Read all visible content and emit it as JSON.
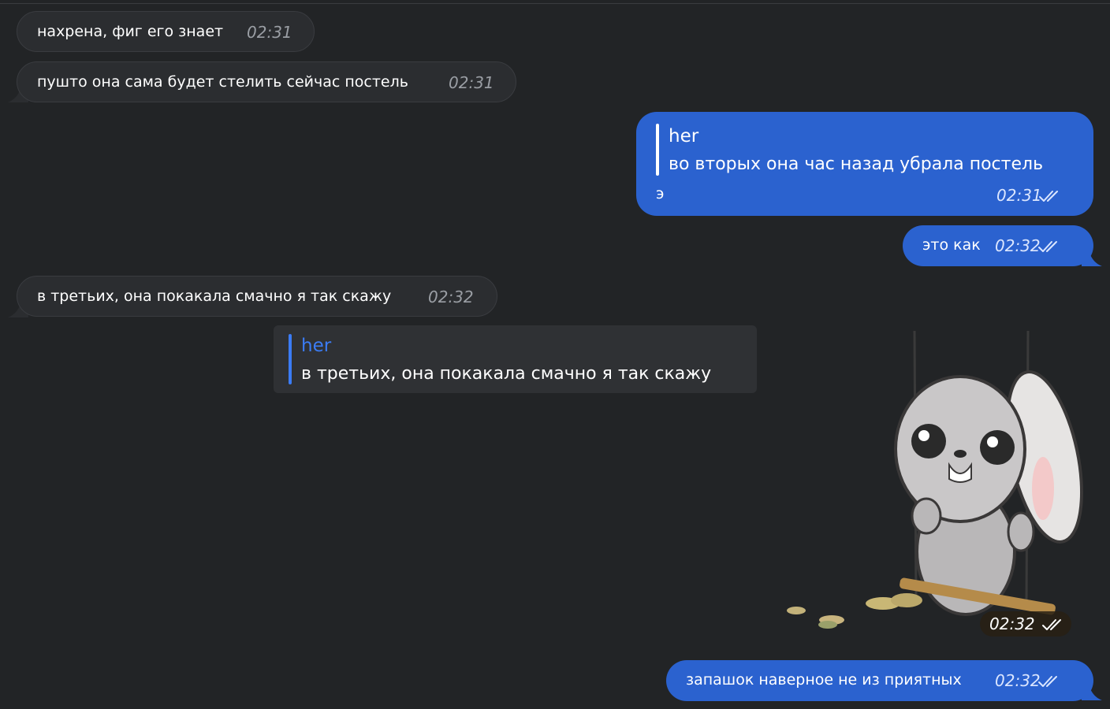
{
  "messages": [
    {
      "text": "нахрена, фиг его знает",
      "time": "02:31"
    },
    {
      "text": "пушто она сама будет стелить сейчас постель",
      "time": "02:31"
    },
    {
      "reply_author": "her",
      "reply_text": "во вторых она час назад убрала постель",
      "text": "э",
      "time": "02:31"
    },
    {
      "text": "это как",
      "time": "02:32"
    },
    {
      "text": "в третьих, она покакала смачно я так скажу",
      "time": "02:32"
    },
    {
      "sticker": "bunny-on-swing-sticker",
      "time": "02:32"
    },
    {
      "text": "запашок наверное не из приятных",
      "time": "02:32"
    }
  ],
  "reply_preview": {
    "author": "her",
    "text": "в третьих, она покакала смачно я так скажу"
  },
  "colors": {
    "background": "#222426",
    "incoming_bubble": "#2b2d30",
    "outgoing_bubble": "#2b62cf",
    "reply_accent": "#3b7cf5"
  },
  "icons": [
    "double-check-icon"
  ]
}
